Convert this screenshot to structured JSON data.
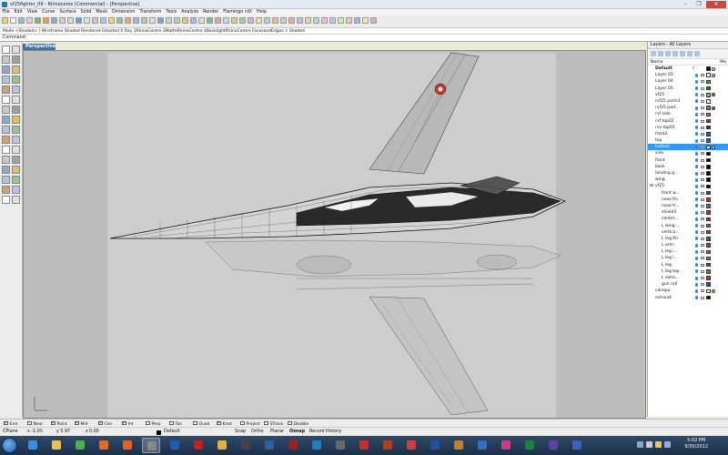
{
  "window": {
    "title": "vf25fighter_09 - Rhinoceros (Commercial) - [Perspective]",
    "minimize": "–",
    "maximize": "❐",
    "close": "✕"
  },
  "menu": [
    "File",
    "Edit",
    "View",
    "Curve",
    "Surface",
    "Solid",
    "Mesh",
    "Dimension",
    "Transform",
    "Tools",
    "Analyze",
    "Render",
    "Flamingo nXt",
    "Help"
  ],
  "command_history": "Mode <Shaded> ( Wireframe  Shaded  Rendered  Ghosted  X Ray  1RhinoCentre  3MatteRhinoCentre  4BacklightRhinoCentre  FacesandEdges ): Shaded",
  "command_prompt": "Command:",
  "viewport": {
    "tab": "Perspective"
  },
  "layers": {
    "title": "Layers - All Layers",
    "column_name": "Name",
    "column_extra": "Ma",
    "rows": [
      {
        "name": "Default",
        "bold": true,
        "check": "✓",
        "color": "#000000",
        "mat": "#ffffff",
        "indent": 0
      },
      {
        "name": "Layer 03",
        "color": "#ffffff",
        "mat": "#f6e25a",
        "indent": 0
      },
      {
        "name": "Layer 04",
        "color": "#22cc22",
        "mat": "",
        "indent": 0
      },
      {
        "name": "Layer 05",
        "color": "#1f5fd0",
        "mat": "",
        "indent": 0
      },
      {
        "name": "vf25",
        "color": "#66cc66",
        "mat": "#2f9e5a",
        "indent": 0
      },
      {
        "name": "rvf25 parts1",
        "color": "#ffffff",
        "mat": "",
        "indent": 0
      },
      {
        "name": "rvf25 part...",
        "color": "#7a7a7a",
        "mat": "#2f9e5a",
        "indent": 0
      },
      {
        "name": "rvf side",
        "color": "#d050d0",
        "mat": "",
        "indent": 0
      },
      {
        "name": "rvf top02",
        "color": "#b03030",
        "mat": "",
        "indent": 0
      },
      {
        "name": "rvv top01",
        "color": "#3030a0",
        "mat": "",
        "indent": 0
      },
      {
        "name": "front2",
        "color": "#1f5fd0",
        "mat": "",
        "indent": 0
      },
      {
        "name": "top",
        "color": "#1f5fd0",
        "mat": "",
        "indent": 0
      },
      {
        "name": "bottom",
        "color": "#ffffff",
        "mat": "#ffffff",
        "indent": 0,
        "selected": true
      },
      {
        "name": "side",
        "color": "#000000",
        "mat": "",
        "indent": 0
      },
      {
        "name": "front",
        "color": "#000000",
        "mat": "",
        "indent": 0
      },
      {
        "name": "back",
        "color": "#000000",
        "mat": "",
        "indent": 0
      },
      {
        "name": "landing g...",
        "color": "#000000",
        "mat": "",
        "indent": 0
      },
      {
        "name": "wing",
        "color": "#000000",
        "mat": "",
        "indent": 0
      },
      {
        "name": "vf25",
        "color": "#000000",
        "mat": "",
        "indent": 0,
        "expander": "⊟"
      },
      {
        "name": "front w...",
        "color": "#3050c0",
        "mat": "",
        "indent": 1
      },
      {
        "name": "nose fin",
        "color": "#c03030",
        "mat": "",
        "indent": 1
      },
      {
        "name": "nose fr...",
        "color": "#a04ab0",
        "mat": "",
        "indent": 1
      },
      {
        "name": "shield3",
        "color": "#c03030",
        "mat": "",
        "indent": 1
      },
      {
        "name": "center...",
        "color": "#c03030",
        "mat": "",
        "indent": 1
      },
      {
        "name": "L wing ...",
        "color": "#a04ab0",
        "mat": "",
        "indent": 1
      },
      {
        "name": "vertica...",
        "color": "#c03030",
        "mat": "",
        "indent": 1
      },
      {
        "name": "L leg fin",
        "color": "#3050c0",
        "mat": "",
        "indent": 1
      },
      {
        "name": "L arm",
        "color": "#c03030",
        "mat": "",
        "indent": 1
      },
      {
        "name": "L leg i...",
        "color": "#a04ab0",
        "mat": "",
        "indent": 1
      },
      {
        "name": "L leg i...",
        "color": "#c07020",
        "mat": "",
        "indent": 1
      },
      {
        "name": "L leg",
        "color": "#c03030",
        "mat": "",
        "indent": 1
      },
      {
        "name": "L leg top",
        "color": "#a04ab0",
        "mat": "",
        "indent": 1
      },
      {
        "name": "L exha...",
        "color": "#c03030",
        "mat": "",
        "indent": 1
      },
      {
        "name": "gun rail",
        "color": "#3050c0",
        "mat": "",
        "indent": 1
      },
      {
        "name": "canopy",
        "color": "#ffffff",
        "mat": "#f6e25a",
        "indent": 0
      },
      {
        "name": "exhaust",
        "color": "#000000",
        "mat": "",
        "indent": 0
      }
    ]
  },
  "osnaps": [
    {
      "label": "End",
      "on": true
    },
    {
      "label": "Near",
      "on": false
    },
    {
      "label": "Point",
      "on": true
    },
    {
      "label": "Mid",
      "on": true
    },
    {
      "label": "Cen",
      "on": true
    },
    {
      "label": "Int",
      "on": true
    },
    {
      "label": "Perp",
      "on": false
    },
    {
      "label": "Tan",
      "on": false
    },
    {
      "label": "Quad",
      "on": false
    },
    {
      "label": "Knot",
      "on": true
    },
    {
      "label": "Project",
      "on": false
    },
    {
      "label": "STrack",
      "on": false
    },
    {
      "label": "Disable",
      "on": false
    }
  ],
  "status": {
    "cplane": "CPlane",
    "x": "x -1.00",
    "y": "y 5.97",
    "z": "z 0.00",
    "layer": "Default",
    "snap": "Snap",
    "ortho": "Ortho",
    "planar": "Planar",
    "osnap": "Osnap",
    "record_history": "Record History"
  },
  "taskbar": {
    "time": "5:02 PM",
    "date": "9/30/2012"
  },
  "colors": {
    "selected_row": "#3399ff",
    "viewport_tab": "#4c6e98"
  }
}
